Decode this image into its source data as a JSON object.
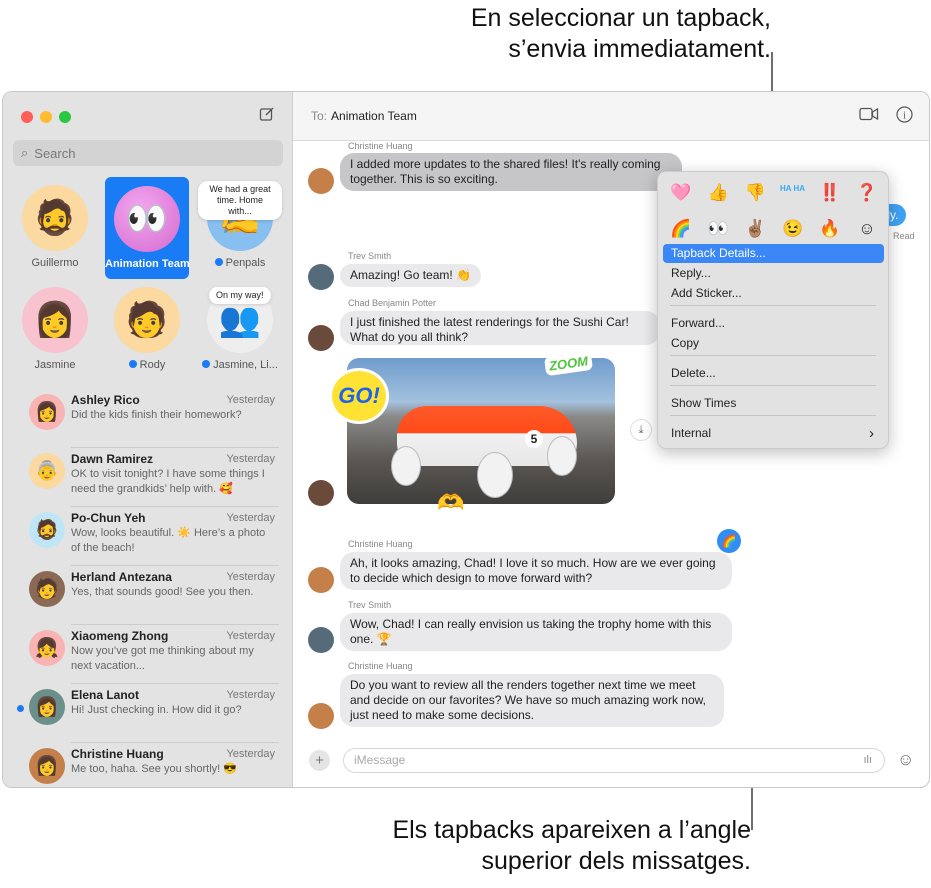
{
  "callouts": {
    "top": [
      "En seleccionar un tapback,",
      "s’envia immediatament."
    ],
    "bottom": [
      "Els tapbacks apareixen a l’angle",
      "superior dels missatges."
    ]
  },
  "window": {
    "traffic_colors": [
      "#fe5f57",
      "#febc2e",
      "#28c840"
    ]
  },
  "sidebar": {
    "search_placeholder": "Search",
    "pinned": [
      {
        "name": "Guillermo",
        "emoji": "🧔",
        "bg": "#fcd9a0",
        "unread": false
      },
      {
        "name": "Animation Team",
        "emoji": "👀",
        "bg": "#e67fd6",
        "unread": false,
        "selected": true
      },
      {
        "name": "Penpals",
        "emoji": "✍️",
        "bg": "#86bff0",
        "unread": true,
        "tip": "We had a great time. Home with..."
      },
      {
        "name": "Jasmine",
        "emoji": "👩",
        "bg": "#f9c2cf",
        "unread": false
      },
      {
        "name": "Rody",
        "emoji": "🧑",
        "bg": "#fcd9a0",
        "unread": true
      },
      {
        "name": "Jasmine, Li...",
        "emoji": "👥",
        "bg": "#eeeeee",
        "unread": true,
        "tip": "On my way!"
      }
    ],
    "conversations": [
      {
        "name": "Ashley Rico",
        "time": "Yesterday",
        "preview": "Did the kids finish their homework?",
        "emoji": "👩",
        "bg": "#f9b3b3",
        "unread": false
      },
      {
        "name": "Dawn Ramirez",
        "time": "Yesterday",
        "preview": "OK to visit tonight? I have some things I need the grandkids’ help with. 🥰",
        "emoji": "👵",
        "bg": "#fcd9a0",
        "unread": false
      },
      {
        "name": "Po-Chun Yeh",
        "time": "Yesterday",
        "preview": "Wow, looks beautiful. ☀️ Here’s a photo of the beach!",
        "emoji": "🧔",
        "bg": "#bfe6f7",
        "unread": false
      },
      {
        "name": "Herland Antezana",
        "time": "Yesterday",
        "preview": "Yes, that sounds good! See you then.",
        "emoji": "🧑",
        "bg": "#8a6a55",
        "unread": false
      },
      {
        "name": "Xiaomeng Zhong",
        "time": "Yesterday",
        "preview": "Now you’ve got me thinking about my next vacation...",
        "emoji": "👧",
        "bg": "#f9b3b3",
        "unread": false
      },
      {
        "name": "Elena Lanot",
        "time": "Yesterday",
        "preview": "Hi! Just checking in. How did it go?",
        "emoji": "👩",
        "bg": "#6b8f8a",
        "unread": true
      },
      {
        "name": "Christine Huang",
        "time": "Yesterday",
        "preview": "Me too, haha. See you shortly! 😎",
        "emoji": "👩",
        "bg": "#c5804a",
        "unread": false
      }
    ]
  },
  "chat": {
    "to_label": "To:",
    "recipient": "Animation Team",
    "messages": [
      {
        "sender": "Christine Huang",
        "text": "I added more updates to the shared files! It's really coming together. This is so exciting."
      },
      {
        "sender": "Trev Smith",
        "text": "Amazing! Go team! 👏"
      },
      {
        "sender": "Chad Benjamin Potter",
        "text": "I just finished the latest renderings for the Sushi Car! What do you all think?"
      },
      {
        "sender": "Christine Huang",
        "text": "Ah, it looks amazing, Chad! I love it so much. How are we ever going to decide which design to move forward with?"
      },
      {
        "sender": "Trev Smith",
        "text": "Wow, Chad! I can really envision us taking the trophy home with this one. 🏆"
      },
      {
        "sender": "Christine Huang",
        "text": "Do you want to review all the renders together next time we meet and decide on our favorites? We have so much amazing work now, just need to make some decisions."
      }
    ],
    "outgoing_fragment": "tly.",
    "read_label": "Read",
    "stickers": {
      "go": "GO!",
      "zoom": "ZOOM",
      "hands": "🫶"
    },
    "car_number": "5",
    "tapback_on_message": "🌈",
    "input_placeholder": "iMessage"
  },
  "menu": {
    "tapbacks_row1": [
      "🩷",
      "👍",
      "👎",
      "HA HA",
      "‼️",
      "❓"
    ],
    "tapbacks_row2": [
      "🌈",
      "👀",
      "✌🏽",
      "😉",
      "🔥",
      "☺"
    ],
    "items": [
      "Tapback Details...",
      "Reply...",
      "Add Sticker...",
      "Forward...",
      "Copy",
      "Delete...",
      "Show Times",
      "Internal"
    ],
    "highlighted": "Tapback Details..."
  }
}
